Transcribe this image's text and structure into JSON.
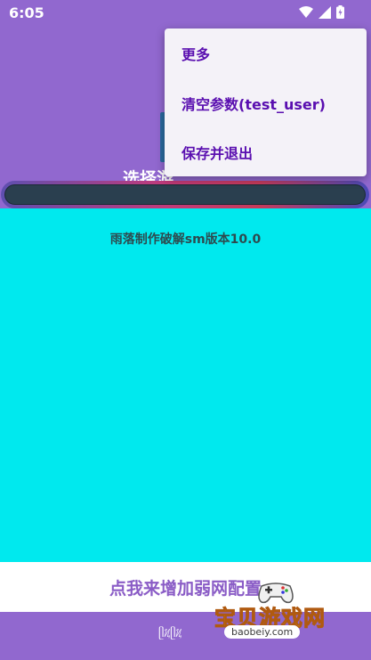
{
  "status_bar": {
    "time": "6:05",
    "icons": [
      "wifi-icon",
      "signal-icon",
      "battery-icon"
    ]
  },
  "header": {
    "title": "选择游"
  },
  "content": {
    "version_text": "雨落制作破解sm版本10.0"
  },
  "bottom": {
    "add_config_label": "点我来增加弱网配置"
  },
  "menu": {
    "items": [
      {
        "label": "更多"
      },
      {
        "label": "清空参数(test_user)"
      },
      {
        "label": "保存并退出"
      }
    ]
  },
  "watermark": {
    "brand": "宝贝游戏网",
    "url": "baobeiy.com",
    "coil": "ᥫᜰᥫᜰ"
  },
  "colors": {
    "primary_purple": "#9168cf",
    "content_cyan": "#00e9ee",
    "menu_text": "#5a0fb0",
    "button_text": "#8a5cc6"
  }
}
